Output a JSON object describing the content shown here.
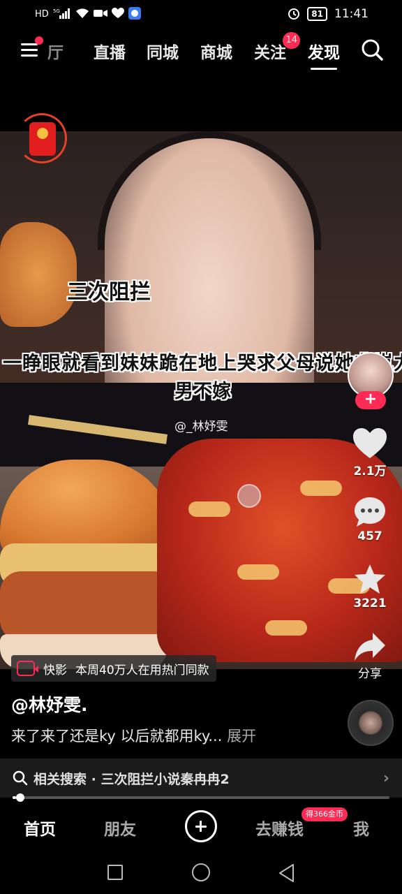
{
  "status_bar": {
    "network_label": "HD",
    "network_type": "5G",
    "battery": "81",
    "time": "11:41",
    "icons": [
      "hd-icon",
      "signal-icon",
      "wifi-icon",
      "video-icon",
      "heart-icon",
      "app-icon",
      "alarm-icon",
      "battery-icon"
    ]
  },
  "top_nav": {
    "tabs": [
      {
        "label": "厅",
        "partial": true
      },
      {
        "label": "直播"
      },
      {
        "label": "同城"
      },
      {
        "label": "商城"
      },
      {
        "label": "关注",
        "badge": "14"
      },
      {
        "label": "发现",
        "active": true
      }
    ],
    "icons": [
      "menu-icon",
      "search-icon"
    ]
  },
  "video": {
    "subtitle_1": "三次阻拦",
    "subtitle_2": "一睁眼就看到妹妹跪在地上哭求父母说她非岚力",
    "subtitle_3": "男不嫁",
    "watermark": "@_林妤雯"
  },
  "actions": {
    "like_count": "2.1万",
    "comment_count": "457",
    "favorite_count": "3221",
    "share_label": "分享",
    "follow_symbol": "+"
  },
  "effect": {
    "name": "快影",
    "text": "本周40万人在用热门同款"
  },
  "post": {
    "author": "@林妤雯.",
    "description": "来了来了还是ky 以后就都用ky...",
    "expand_label": "展开"
  },
  "related_search": {
    "text": "相关搜索 · 三次阻拦小说秦冉冉2"
  },
  "playback": {
    "progress": 0.01
  },
  "bottom_tabs": {
    "home": "首页",
    "friends": "朋友",
    "earn": "去赚钱",
    "earn_badge": "得366金币",
    "me": "我"
  },
  "colors": {
    "accent": "#fe2c55",
    "background": "#000000"
  }
}
